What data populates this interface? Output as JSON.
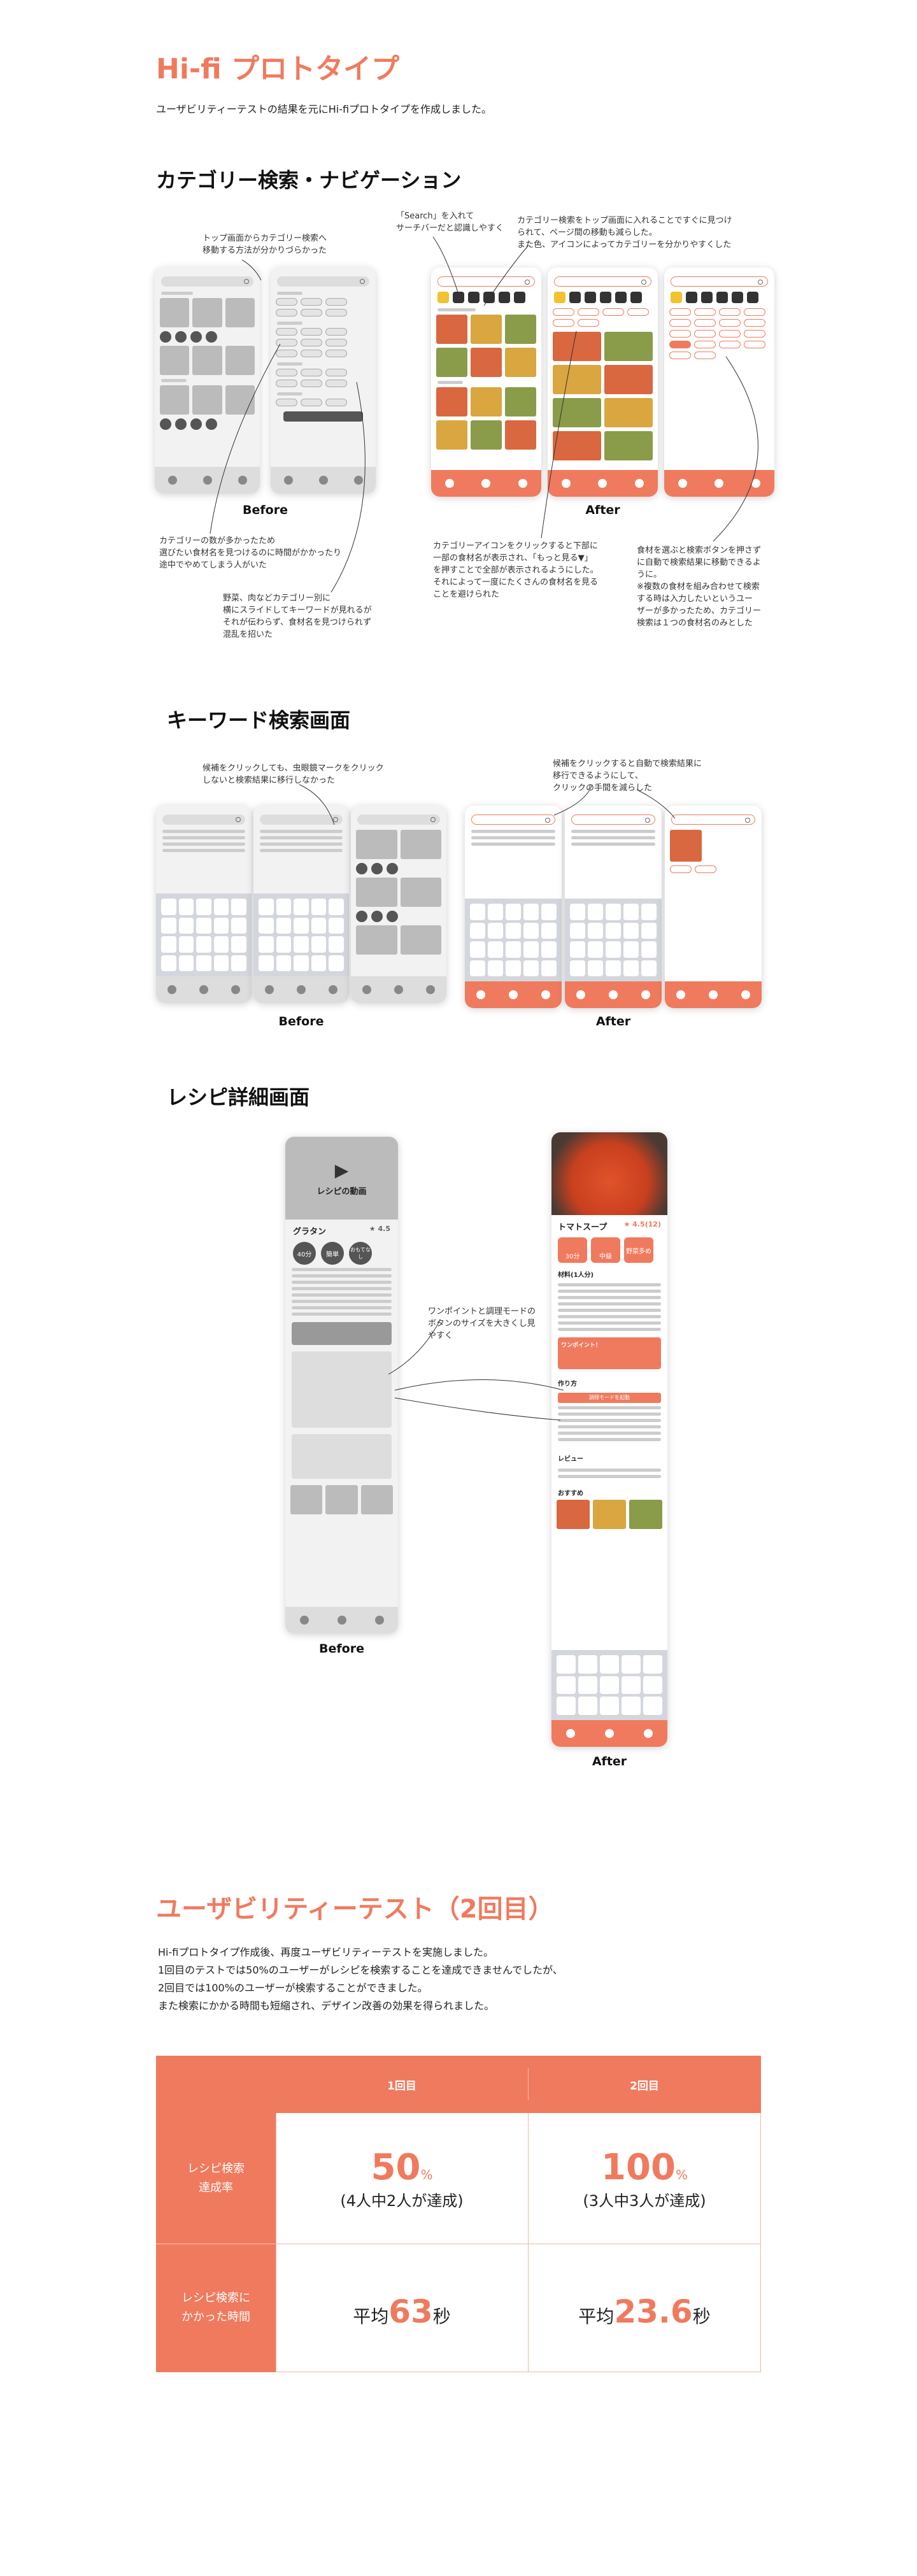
{
  "title": "Hi-fi プロトタイプ",
  "intro": "ユーザビリティーテストの結果を元にHi-fiプロトタイプを作成しました。",
  "section_category": {
    "heading": "カテゴリー検索・ナビゲーション",
    "before_label": "Before",
    "after_label": "After",
    "notes": {
      "before_top": "トップ画面からカテゴリー検索へ\n移動する方法が分かりづらかった",
      "after_search": "「Search」を入れて\nサーチバーだと認識しやすく",
      "after_category": "カテゴリー検索をトップ画面に入れることですぐに見つけ\nられて、ページ間の移動も減らした。\nまた色、アイコンによってカテゴリーを分かりやすくした",
      "before_many": "カテゴリーの数が多かったため\n選びたい食材名を見つけるのに時間がかかったり\n途中でやめてしまう人がいた",
      "before_slide": "野菜、肉などカテゴリー別に\n横にスライドしてキーワードが見れるが\nそれが伝わらず、食材名を見つけられず\n混乱を招いた",
      "after_icon": "カテゴリーアイコンをクリックすると下部に\n一部の食材名が表示され、「もっと見る▼」\nを押すことで全部が表示されるようにした。\nそれによって一度にたくさんの食材名を見る\nことを避けられた",
      "after_select": "食材を選ぶと検索ボタンを押さず\nに自動で検索結果に移動できるよ\nうに。\n※複数の食材を組み合わせて検索\nする時は入力したいというユー\nザーが多かったため、カテゴリー\n検索は１つの食材名のみとした"
    }
  },
  "section_keyword": {
    "heading": "キーワード検索画面",
    "before_label": "Before",
    "after_label": "After",
    "notes": {
      "before": "候補をクリックしても、虫眼鏡マークをクリック\nしないと検索結果に移行しなかった",
      "after": "候補をクリックすると自動で検索結果に\n移行できるようにして、\nクリックの手間を減らした"
    }
  },
  "section_recipe": {
    "heading": "レシピ詳細画面",
    "before_label": "Before",
    "after_label": "After",
    "note": "ワンポイントと調理モードの\nボタンのサイズを大きくし見\nやすく",
    "before_screen": {
      "video_label": "レシピの動画",
      "dish": "グラタン",
      "rating": "4.5",
      "badges": [
        "40分",
        "簡単",
        "おもてなし"
      ]
    },
    "after_screen": {
      "dish": "トマトスープ",
      "rating": "4.5(12)",
      "badges": [
        "30分",
        "中級",
        "野菜多め"
      ],
      "ingredients_label": "材料(1人分)",
      "onepoint": "ワンポイント！",
      "howto": "作り方",
      "cook_mode": "調理モードを起動",
      "review": "レビュー",
      "recommend": "おすすめ"
    }
  },
  "section_test": {
    "heading": "ユーザビリティーテスト（2回目）",
    "paragraph": [
      "Hi-fiプロトタイプ作成後、再度ユーザビリティーテストを実施しました。",
      "1回目のテストでは50%のユーザーがレシピを検索することを達成できませんでしたが、",
      "2回目では100%のユーザーが検索することができました。",
      "また検索にかかる時間も短縮され、デザイン改善の効果を得られました。"
    ],
    "table": {
      "col1": "1回目",
      "col2": "2回目",
      "row1_label": "レシピ検索\n達成率",
      "row2_label": "レシピ検索に\nかかった時間",
      "r1c1_num": "50",
      "r1c1_unit": "%",
      "r1c1_sub": "(4人中2人が達成)",
      "r1c2_num": "100",
      "r1c2_unit": "%",
      "r1c2_sub": "(3人中3人が達成)",
      "r2c1_pre": "平均",
      "r2c1_num": "63",
      "r2c1_unit": "秒",
      "r2c2_pre": "平均",
      "r2c2_num": "23.6",
      "r2c2_unit": "秒"
    }
  },
  "colors": {
    "accent": "#f07a5e",
    "table_border": "#f3b5a6"
  }
}
